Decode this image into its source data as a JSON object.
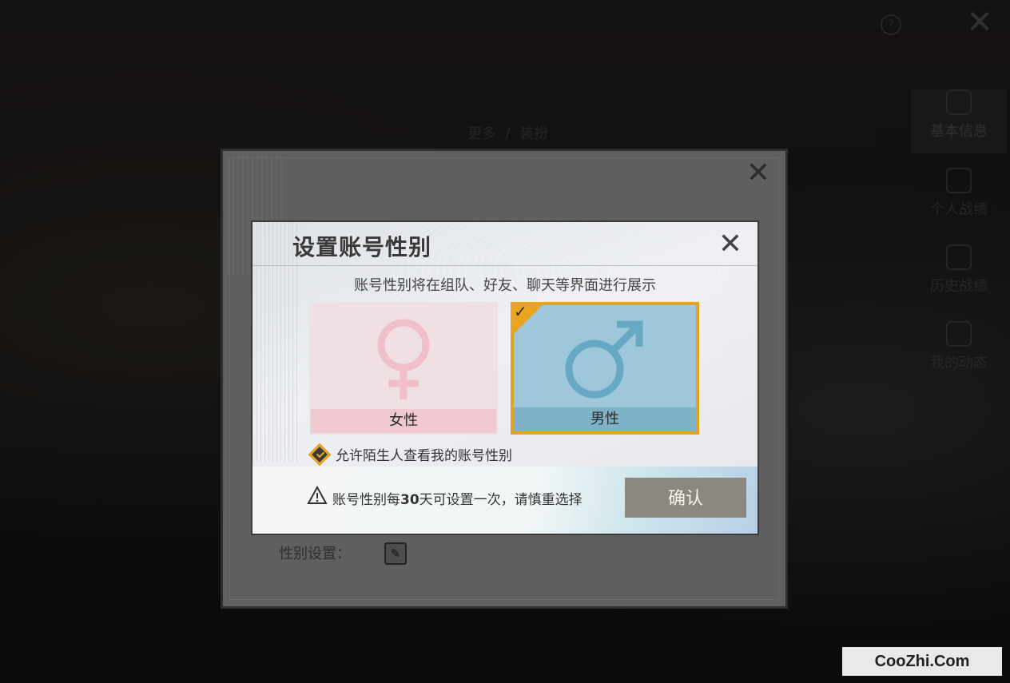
{
  "background": {
    "help_icon": "question-circle-icon",
    "close_icon": "close-icon",
    "top_bar": {
      "more_label": "更多",
      "dress_label": "装扮"
    },
    "side_tabs": [
      {
        "label": "基本信息",
        "icon": "user-shield-icon"
      },
      {
        "label": "个人战绩",
        "icon": "chart-doc-icon"
      },
      {
        "label": "历史战绩",
        "icon": "history-doc-icon"
      },
      {
        "label": "我的动态",
        "icon": "location-icon"
      }
    ]
  },
  "outer_dialog": {
    "gender_setting_label": "性别设置：",
    "edit_icon": "pencil-icon"
  },
  "dialog": {
    "title": "设置账号性别",
    "subtitle": "账号性别将在组队、好友、聊天等界面进行展示",
    "options": [
      {
        "label": "女性",
        "icon": "female-symbol-icon",
        "selected": false,
        "color": "#f0dfe3"
      },
      {
        "label": "男性",
        "icon": "male-symbol-icon",
        "selected": true,
        "color": "#9fc7db"
      }
    ],
    "allow_strangers": {
      "label": "允许陌生人查看我的账号性别",
      "checked": true
    },
    "warning": {
      "prefix": "账号性别每",
      "days": "30",
      "suffix": "天可设置一次，请慎重选择"
    },
    "confirm_label": "确认",
    "accent_color": "#e2a321"
  },
  "watermark": "CooZhi.Com"
}
